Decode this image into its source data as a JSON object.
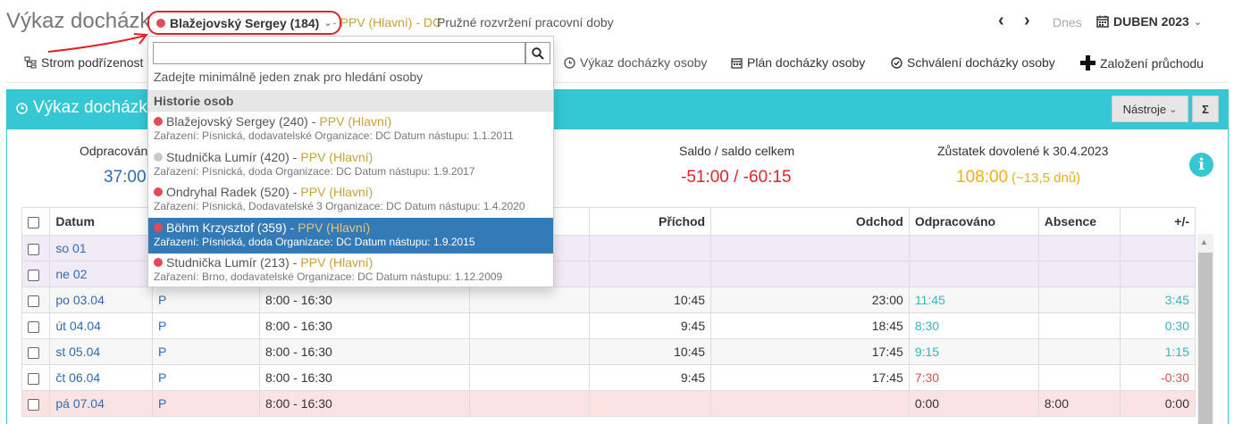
{
  "header": {
    "title": "Výkaz docházky",
    "person": "Blažejovský Sergey (184)",
    "contract": "- PPV (Hlavní) - DC",
    "schedule": "Pružné rozvržení pracovní doby",
    "today_label": "Dnes",
    "month_label": "DUBEN 2023",
    "icons": {
      "prev": "chevron-left-icon",
      "next": "chevron-right-icon",
      "calendar": "calendar-icon"
    }
  },
  "toolbar": {
    "subordinates_label": "Strom podřízenost",
    "person_report_label": "Výkaz docházky osoby",
    "person_plan_label": "Plán docházky osoby",
    "approval_label": "Schválení docházky osoby",
    "new_passage_label": "Založení průchodu"
  },
  "panel": {
    "title": "Výkaz docházky",
    "tools_label": "Nástroje",
    "sigma_label": "Σ"
  },
  "stats": {
    "worked_label": "Odpracováno",
    "worked_value": "37:00",
    "saldo_label": "Saldo / saldo celkem",
    "saldo_value": "-51:00 / -60:15",
    "vacation_label": "Zůstatek dovolené k 30.4.2023",
    "vacation_value": "108:00",
    "vacation_days": "(~13,5 dnů)",
    "colors": {
      "worked": "#2f6bb3",
      "saldo": "#d9262b",
      "vacation": "#f0ad1c"
    }
  },
  "table": {
    "headers": [
      "Datum",
      "",
      "",
      "",
      "Příchod",
      "Odchod",
      "Odpracováno",
      "Absence",
      "+/-",
      ""
    ],
    "rows": [
      {
        "date": "so 01",
        "type": "",
        "shift": "",
        "note": "",
        "in": "",
        "out": "",
        "worked": "",
        "absence": "",
        "diff": "",
        "kind": "weekend"
      },
      {
        "date": "ne 02",
        "type": "",
        "shift": "",
        "note": "",
        "in": "",
        "out": "",
        "worked": "",
        "absence": "",
        "diff": "",
        "kind": "weekend"
      },
      {
        "date": "po 03.04",
        "type": "P",
        "shift": "8:00 - 16:30",
        "note": "",
        "in": "10:45",
        "out": "23:00",
        "worked": "11:45",
        "absence": "",
        "diff": "3:45",
        "kind": "alt"
      },
      {
        "date": "út 04.04",
        "type": "P",
        "shift": "8:00 - 16:30",
        "note": "",
        "in": "9:45",
        "out": "18:45",
        "worked": "8:30",
        "absence": "",
        "diff": "0:30",
        "kind": "normal"
      },
      {
        "date": "st 05.04",
        "type": "P",
        "shift": "8:00 - 16:30",
        "note": "",
        "in": "10:45",
        "out": "17:45",
        "worked": "9:15",
        "absence": "",
        "diff": "1:15",
        "kind": "alt"
      },
      {
        "date": "čt 06.04",
        "type": "P",
        "shift": "8:00 - 16:30",
        "note": "",
        "in": "9:45",
        "out": "17:45",
        "worked": "7:30",
        "absence": "",
        "diff": "-0:30",
        "kind": "normal"
      },
      {
        "date": "pá 07.04",
        "type": "P",
        "shift": "8:00 - 16:30",
        "note": "",
        "in": "",
        "out": "",
        "worked": "0:00",
        "absence": "8:00",
        "diff": "0:00",
        "kind": "absent"
      }
    ]
  },
  "dropdown": {
    "search_value": "",
    "hint": "Zadejte minimálně jeden znak pro hledání osoby",
    "history_label": "Historie osob",
    "items": [
      {
        "name": "Blažejovský Sergey (240)",
        "contract": "PPV (Hlavní)",
        "detail": "Zařazení: Písnická, dodavatelské Organizace: DC Datum nástupu: 1.1.2011",
        "dot": "red",
        "active": false
      },
      {
        "name": "Studnička Lumír (420)",
        "contract": "PPV (Hlavní)",
        "detail": "Zařazení: Písnická, doda Organizace: DC Datum nástupu: 1.9.2017",
        "dot": "grey",
        "active": false
      },
      {
        "name": "Ondryhal Radek (520)",
        "contract": "PPV (Hlavní)",
        "detail": "Zařazení: Písnická, Dodavatelské 3 Organizace: DC Datum nástupu: 1.4.2020",
        "dot": "red",
        "active": false
      },
      {
        "name": "Böhm Krzysztof (359)",
        "contract": "PPV (Hlavní)",
        "detail": "Zařazení: Písnická, doda Organizace: DC Datum nástupu: 1.9.2015",
        "dot": "red",
        "active": true
      },
      {
        "name": "Studnička Lumír (213)",
        "contract": "PPV (Hlavní)",
        "detail": "Zařazení: Brno, dodavatelské Organizace: DC Datum nástupu: 1.12.2009",
        "dot": "red",
        "active": false
      }
    ]
  }
}
